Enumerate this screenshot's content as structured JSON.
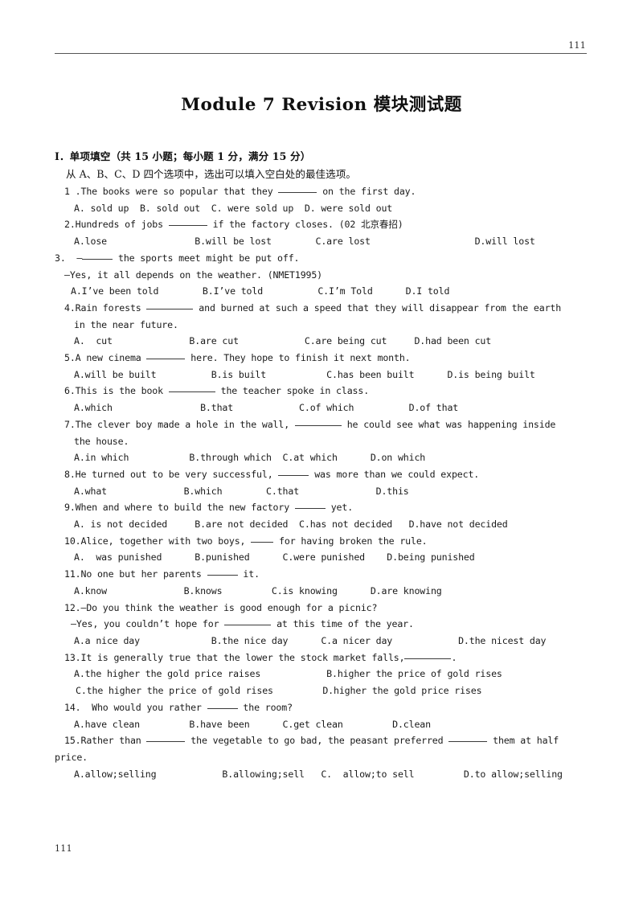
{
  "header": {
    "page_number": "111"
  },
  "title": "Module 7   Revision  模块测试题",
  "section": {
    "heading": "I．单项填空（共 15 小题；每小题 1 分，满分 15 分）",
    "instruction": "从 A、B、C、D 四个选项中，选出可以填入空白处的最佳选项。"
  },
  "questions": [
    {
      "id": "q1",
      "stem": "1 .The books were so popular that they ______ on the first day.",
      "stem_pre": "1 .The books were so popular that they ",
      "stem_post": " on the first day.",
      "options": "A. sold up  B. sold out  C. were sold up  D. were sold out"
    },
    {
      "id": "q2",
      "stem_pre": "2.Hundreds of jobs ",
      "stem_post": " if the factory closes. (02 北京春招)",
      "options": "A.lose                B.will be lost        C.are lost                   D.will lost"
    },
    {
      "id": "q3",
      "stem_pre": "3.  —",
      "stem_post": " the sports meet might be put off.",
      "continuation": "—Yes, it all depends on the weather. (NMET1995)",
      "options": "A.I’ve been told        B.I’ve told          C.I’m Told      D.I told"
    },
    {
      "id": "q4",
      "stem_pre": "4.Rain forests ",
      "stem_post": " and burned at such a speed that they will disappear from the earth",
      "continuation": "in the near future.",
      "options": "A.  cut              B.are cut            C.are being cut     D.had been cut"
    },
    {
      "id": "q5",
      "stem_pre": "5.A new cinema ",
      "stem_post": " here. They hope to finish it next month.",
      "options": "A.will be built          B.is built           C.has been built      D.is being built"
    },
    {
      "id": "q6",
      "stem_pre": "6.This is the book ",
      "stem_post": " the teacher spoke in class.",
      "options": "A.which                B.that            C.of which          D.of that"
    },
    {
      "id": "q7",
      "stem_pre": "7.The clever boy made a hole in the wall, ",
      "stem_post": " he could see what was happening inside",
      "continuation": "the house.",
      "options": "A.in which           B.through which  C.at which      D.on which"
    },
    {
      "id": "q8",
      "stem_pre": "8.He turned out to be very successful, ",
      "stem_post": " was more than we could expect.",
      "options": "A.what              B.which        C.that              D.this"
    },
    {
      "id": "q9",
      "stem_pre": "9.When and where to build the new factory ",
      "stem_post": " yet.",
      "options": "A. is not decided     B.are not decided  C.has not decided   D.have not decided"
    },
    {
      "id": "q10",
      "stem_pre": "10.Alice, together with two boys, ",
      "stem_post": " for having broken the rule.",
      "options": "A.  was punished      B.punished      C.were punished    D.being punished"
    },
    {
      "id": "q11",
      "stem_pre": "11.No one but her parents ",
      "stem_post": " it.",
      "options": "A.know              B.knows         C.is knowing      D.are knowing"
    },
    {
      "id": "q12",
      "stem_pre": "12.—Do you think the weather is good enough for a picnic?",
      "stem_post": "",
      "continuation_pre": "—Yes, you couldn’t hope for ",
      "continuation_post": " at this time of the year.",
      "options": "A.a nice day             B.the nice day      C.a nicer day            D.the nicest day"
    },
    {
      "id": "q13",
      "stem_pre": "13.It is generally true that the lower the stock market falls,",
      "stem_post": ".",
      "options_line1": "A.the higher the gold price raises            B.higher the price of gold rises",
      "options_line2": "C.the higher the price of gold rises         D.higher the gold price rises"
    },
    {
      "id": "q14",
      "stem_pre": "14.  Who would you rather ",
      "stem_post": " the room?",
      "options": "A.have clean         B.have been      C.get clean         D.clean"
    },
    {
      "id": "q15",
      "stem_pre": "15.Rather than ",
      "stem_mid": " the vegetable to go bad, the peasant preferred ",
      "stem_post": " them at half",
      "continuation": "price.",
      "options": "A.allow;selling            B.allowing;sell   C.  allow;to sell         D.to allow;selling"
    }
  ],
  "footer": {
    "page_number": "111"
  }
}
